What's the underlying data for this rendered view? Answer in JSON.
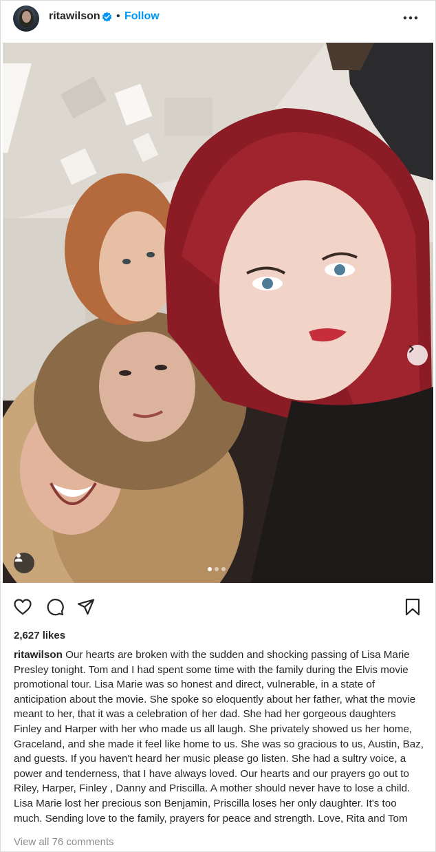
{
  "post": {
    "username": "ritawilson",
    "separator": "•",
    "follow_label": "Follow",
    "likes": "2,627 likes",
    "caption_user": "ritawilson",
    "caption_text": " Our hearts are broken with the sudden and shocking passing of Lisa Marie Presley tonight. Tom and I had spent some time with the family during the Elvis movie promotional tour. Lisa Marie was so honest and direct, vulnerable, in a state of anticipation about the movie. She spoke so eloquently about her father, what the movie meant to her, that it was a celebration of her dad. She had her gorgeous daughters Finley and Harper with her who made us all laugh. She privately showed us her home, Graceland, and she made it feel like home to us. She was so gracious to us, Austin, Baz, and guests. If you haven't heard her music please go listen. She had a sultry voice, a power and tenderness, that I have always loved. Our hearts and our prayers go out to Riley, Harper, Finley , Danny and Priscilla. A mother should never have to lose a child. Lisa Marie lost her precious son Benjamin, Priscilla loses her only daughter. It's too much. Sending love to the family, prayers for peace and strength. Love, Rita and Tom",
    "view_comments": "View all 76 comments",
    "carousel": {
      "total": 3,
      "current": 1
    }
  },
  "icons": {
    "verified": "verified-badge-icon",
    "more": "more-options-icon",
    "like": "heart-icon",
    "comment": "comment-icon",
    "share": "paper-plane-icon",
    "save": "bookmark-icon",
    "next": "chevron-right-icon",
    "tags": "user-tag-icon"
  },
  "colors": {
    "accent": "#0095f6",
    "text": "#262626",
    "muted": "#8e8e8e"
  }
}
